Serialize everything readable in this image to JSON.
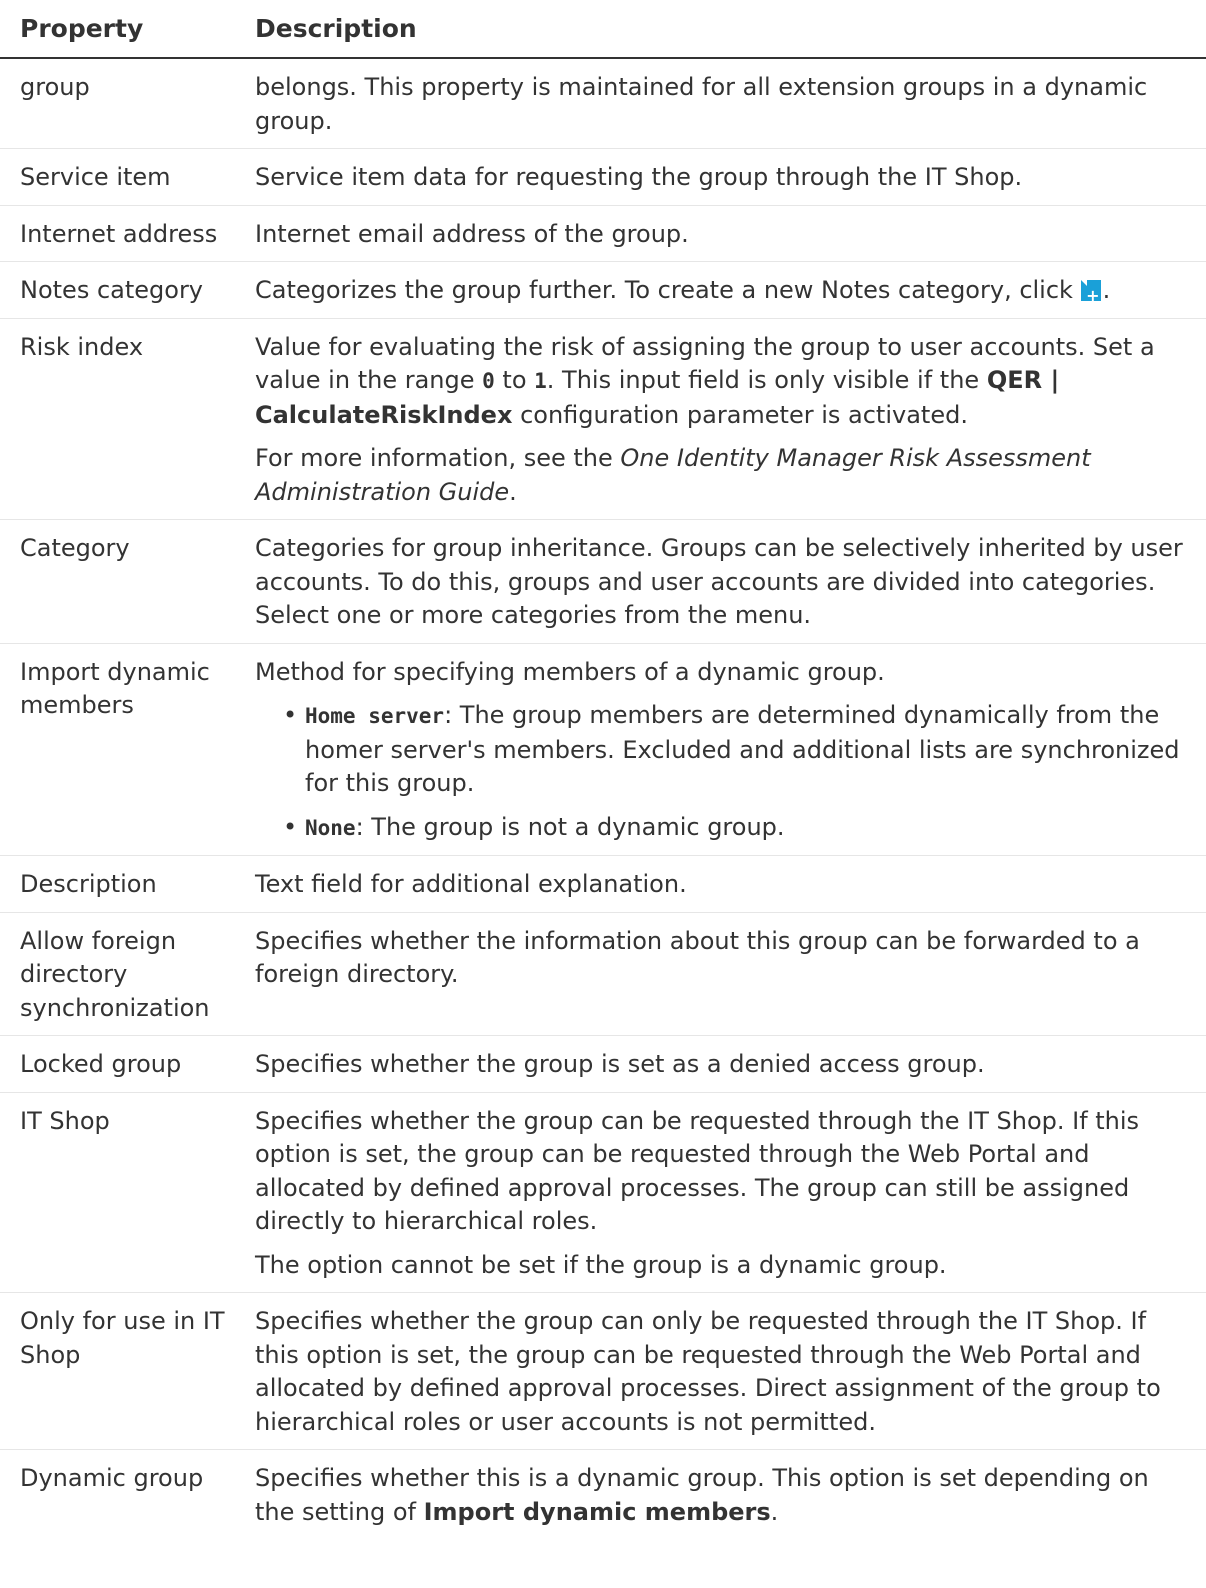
{
  "table": {
    "header": {
      "property": "Property",
      "description": "Description"
    },
    "rows": {
      "group": {
        "prop": "group",
        "desc": "belongs. This property is maintained for all extension groups in a dynamic group."
      },
      "service_item": {
        "prop": "Service item",
        "desc": "Service item data for requesting the group through the IT Shop."
      },
      "internet_address": {
        "prop": "Internet address",
        "desc": "Internet email address of the group."
      },
      "notes_category": {
        "prop": "Notes category",
        "desc_before": "Categorizes the group further. To create a new Notes category, click ",
        "icon": "add-new-icon",
        "desc_after": "."
      },
      "risk_index": {
        "prop": "Risk index",
        "p1_a": "Value for evaluating the risk of assigning the group to user accounts. Set a value in the range ",
        "p1_v0": "0",
        "p1_b": " to ",
        "p1_v1": "1",
        "p1_c": ". This input field is only visible if the ",
        "p1_param": "QER | CalculateRiskIndex",
        "p1_d": " configuration parameter is activated.",
        "p2_a": "For more information, see the ",
        "p2_guide": "One Identity Manager Risk Assessment Administration Guide",
        "p2_b": "."
      },
      "category": {
        "prop": "Category",
        "desc": "Categories for group inheritance. Groups can be selectively inherited by user accounts. To do this, groups and user accounts are divided into categories. Select one or more categories from the menu."
      },
      "import_dynamic": {
        "prop": "Import dynamic members",
        "desc": "Method for specifying members of a dynamic group.",
        "bullet": "•",
        "opt1_code": "Home server",
        "opt1_text": ": The group members are determined dynamically from the homer server's members. Excluded and additional lists are synchronized for this group.",
        "opt2_code": "None",
        "opt2_text": ": The group is not a dynamic group."
      },
      "description": {
        "prop": "Description",
        "desc": "Text field for additional explanation."
      },
      "allow_foreign": {
        "prop": "Allow foreign directory synchronization",
        "desc": "Specifies whether the information about this group can be forwarded to a foreign directory."
      },
      "locked_group": {
        "prop": "Locked group",
        "desc": "Specifies whether the group is set as a denied access group."
      },
      "it_shop": {
        "prop": "IT Shop",
        "p1": "Specifies whether the group can be requested through the IT Shop. If this option is set, the group can be requested through the Web Portal and allocated by defined approval processes. The group can still be assigned directly to hierarchical roles.",
        "p2": "The option cannot be set if the group is a dynamic group."
      },
      "only_it_shop": {
        "prop": "Only for use in IT Shop",
        "desc": "Specifies whether the group can only be requested through the IT Shop. If this option is set, the group can be requested through the Web Portal and allocated by defined approval processes. Direct assignment of the group to hierarchical roles or user accounts is not permitted."
      },
      "dynamic_group": {
        "prop": "Dynamic group",
        "desc_a": "Specifies whether this is a dynamic group. This option is set depending on the setting of ",
        "desc_bold": "Import dynamic members",
        "desc_b": "."
      }
    }
  }
}
